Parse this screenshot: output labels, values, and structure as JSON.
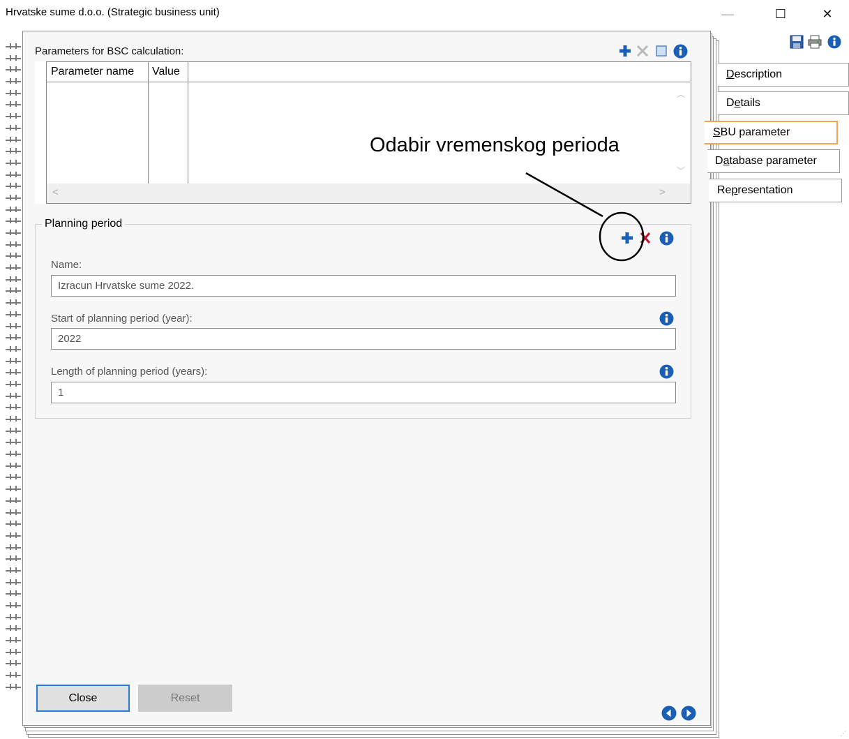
{
  "window": {
    "title": "Hrvatske sume d.o.o. (Strategic business unit)",
    "minimize_glyph": "—",
    "maximize_glyph": "☐",
    "close_glyph": "✕"
  },
  "toolbar": {
    "icons": [
      "save-icon",
      "print-icon",
      "info-icon"
    ]
  },
  "bsc_section": {
    "title": "Parameters for BSC calculation:",
    "columns": [
      "Parameter name",
      "Value"
    ],
    "rows": [],
    "icons": [
      "add-icon",
      "delete-icon",
      "select-all-icon",
      "info-icon"
    ]
  },
  "planning_period": {
    "title": "Planning period",
    "icons": [
      "add-icon",
      "delete-icon",
      "info-icon"
    ],
    "fields": {
      "name": {
        "label": "Name:",
        "value": "Izracun Hrvatske sume 2022."
      },
      "start": {
        "label": "Start of planning period (year):",
        "value": "2022"
      },
      "length": {
        "label": "Length of planning period (years):",
        "value": "1"
      }
    }
  },
  "buttons": {
    "close": "Close",
    "reset": "Reset"
  },
  "tabs": [
    {
      "pre": "",
      "mn": "D",
      "post": "escription",
      "active": false
    },
    {
      "pre": "D",
      "mn": "e",
      "post": "tails",
      "active": false
    },
    {
      "pre": "",
      "mn": "S",
      "post": "BU parameter",
      "active": true
    },
    {
      "pre": "D",
      "mn": "a",
      "post": "tabase parameter",
      "active": false
    },
    {
      "pre": "Re",
      "mn": "p",
      "post": "resentation",
      "active": false
    }
  ],
  "annotation": {
    "text": "Odabir vremenskog perioda"
  },
  "colors": {
    "accent_blue": "#1a5fb4",
    "delete_red": "#c0102a",
    "active_tab_border": "#f0a45a",
    "default_button_border": "#2a7ad6"
  }
}
